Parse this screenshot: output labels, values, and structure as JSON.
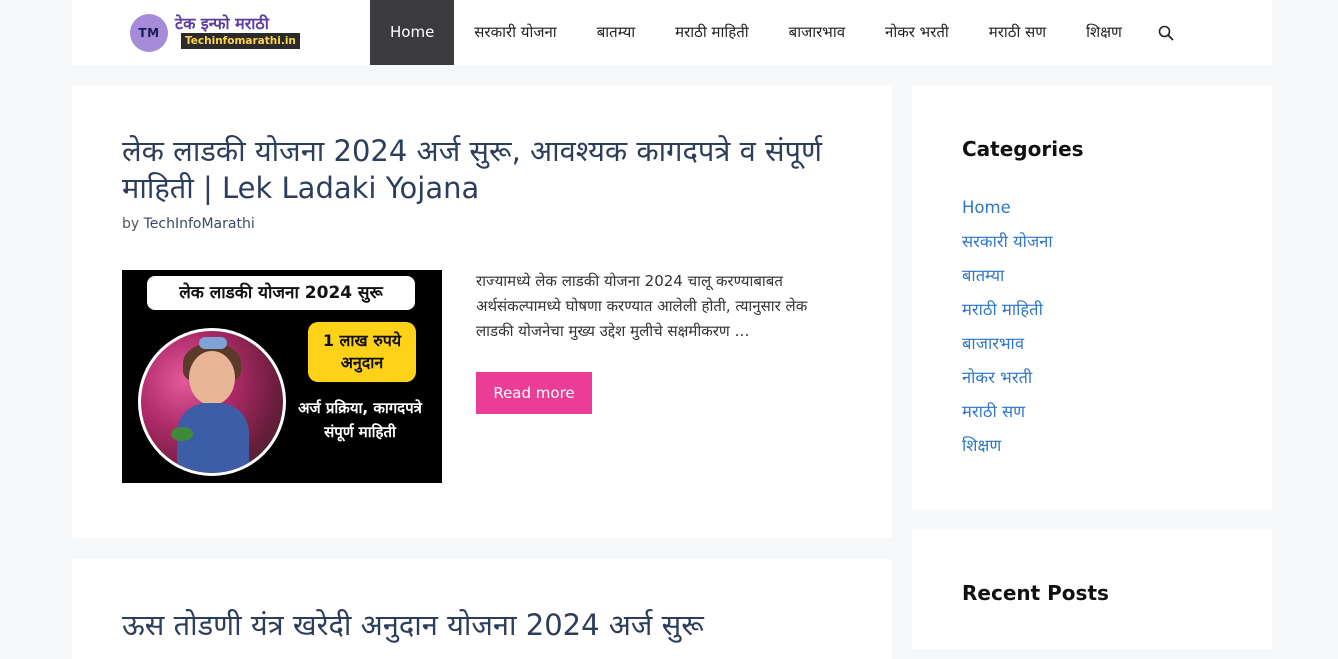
{
  "header": {
    "logo_initials": "TM",
    "logo_title": "टेक इन्फो मराठी",
    "logo_domain": "Techinfomarathi.in",
    "nav": [
      "Home",
      "सरकारी योजना",
      "बातम्या",
      "मराठी माहिती",
      "बाजारभाव",
      "नोकर भरती",
      "मराठी सण",
      "शिक्षण"
    ],
    "active_nav": "Home",
    "search_icon": "search-icon"
  },
  "post": {
    "title": "लेक लाडकी योजना 2024 अर्ज सुरू, आवश्यक कागदपत्रे व संपूर्ण माहिती | Lek Ladaki Yojana",
    "by_label": "by",
    "author": "TechInfoMarathi",
    "thumbnail": {
      "banner": "लेक लाडकी योजना 2024 सुरू",
      "badge_line1": "1 लाख रुपये",
      "badge_line2": "अनुदान",
      "caption": "अर्ज प्रक्रिया, कागदपत्रे संपूर्ण माहिती"
    },
    "excerpt": "राज्यामध्ये लेक लाडकी योजना 2024 चालू करण्याबाबत अर्थसंकल्पामध्ये घोषणा करण्यात आलेली होती, त्यानुसार लेक लाडकी योजनेचा मुख्य उद्देश मुलीचे सक्षमीकरण …",
    "read_more": "Read more"
  },
  "next_post": {
    "title": "ऊस तोडणी यंत्र खरेदी अनुदान योजना 2024 अर्ज सुरू"
  },
  "sidebar": {
    "categories_title": "Categories",
    "categories": [
      "Home",
      "सरकारी योजना",
      "बातम्या",
      "मराठी माहिती",
      "बाजारभाव",
      "नोकर भरती",
      "मराठी सण",
      "शिक्षण"
    ],
    "recent_posts_title": "Recent Posts"
  },
  "colors": {
    "nav_active_bg": "#3a3a3f",
    "title": "#2d3e5c",
    "link": "#2f76c8",
    "button": "#ec3d96"
  }
}
